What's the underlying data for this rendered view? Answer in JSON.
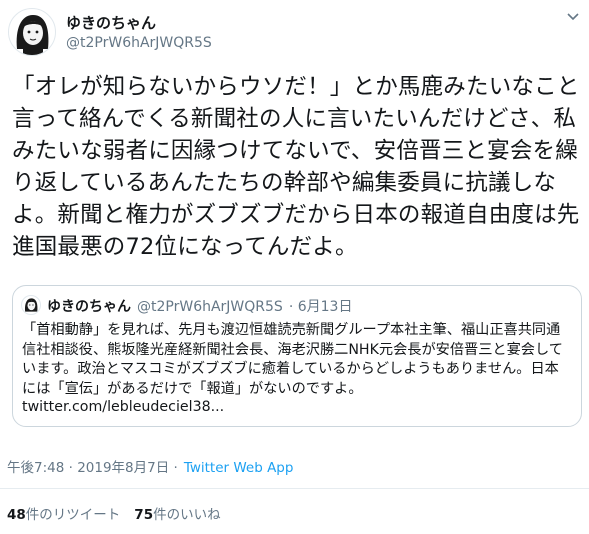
{
  "author": {
    "name": "ゆきのちゃん",
    "handle": "@t2PrW6hArJWQR5S"
  },
  "tweet": {
    "text": "「オレが知らないからウソだ！」とか馬鹿みたいなこと言って絡んでくる新聞社の人に言いたいんだけどさ、私みたいな弱者に因縁つけてないで、安倍晋三と宴会を繰り返しているあんたたちの幹部や編集委員に抗議しなよ。新聞と権力がズブズブだから日本の報道自由度は先進国最悪の72位になってんだよ。",
    "timestamp": "午後7:48 · 2019年8月7日 ·",
    "source": "Twitter Web App"
  },
  "quoted": {
    "name": "ゆきのちゃん",
    "handle": "@t2PrW6hArJWQR5S",
    "date": "· 6月13日",
    "text": "「首相動静」を見れば、先月も渡辺恒雄読売新聞グループ本社主筆、福山正喜共同通信社相談役、熊坂隆光産経新聞社会長、海老沢勝二NHK元会長が安倍晋三と宴会しています。政治とマスコミがズブズブに癒着しているからどしようもありません。日本には「宣伝」があるだけで「報道」がないのですよ。",
    "link": "twitter.com/lebleudeciel38..."
  },
  "stats": {
    "retweets_count": "48",
    "retweets_label": "件のリツイート",
    "likes_count": "75",
    "likes_label": "件のいいね"
  },
  "icons": {
    "caret": "chevron-down-icon",
    "avatar": "avatar-illustration"
  },
  "colors": {
    "link": "#1da1f2",
    "muted": "#657786",
    "text": "#14171a",
    "border": "#ccd6dd"
  }
}
